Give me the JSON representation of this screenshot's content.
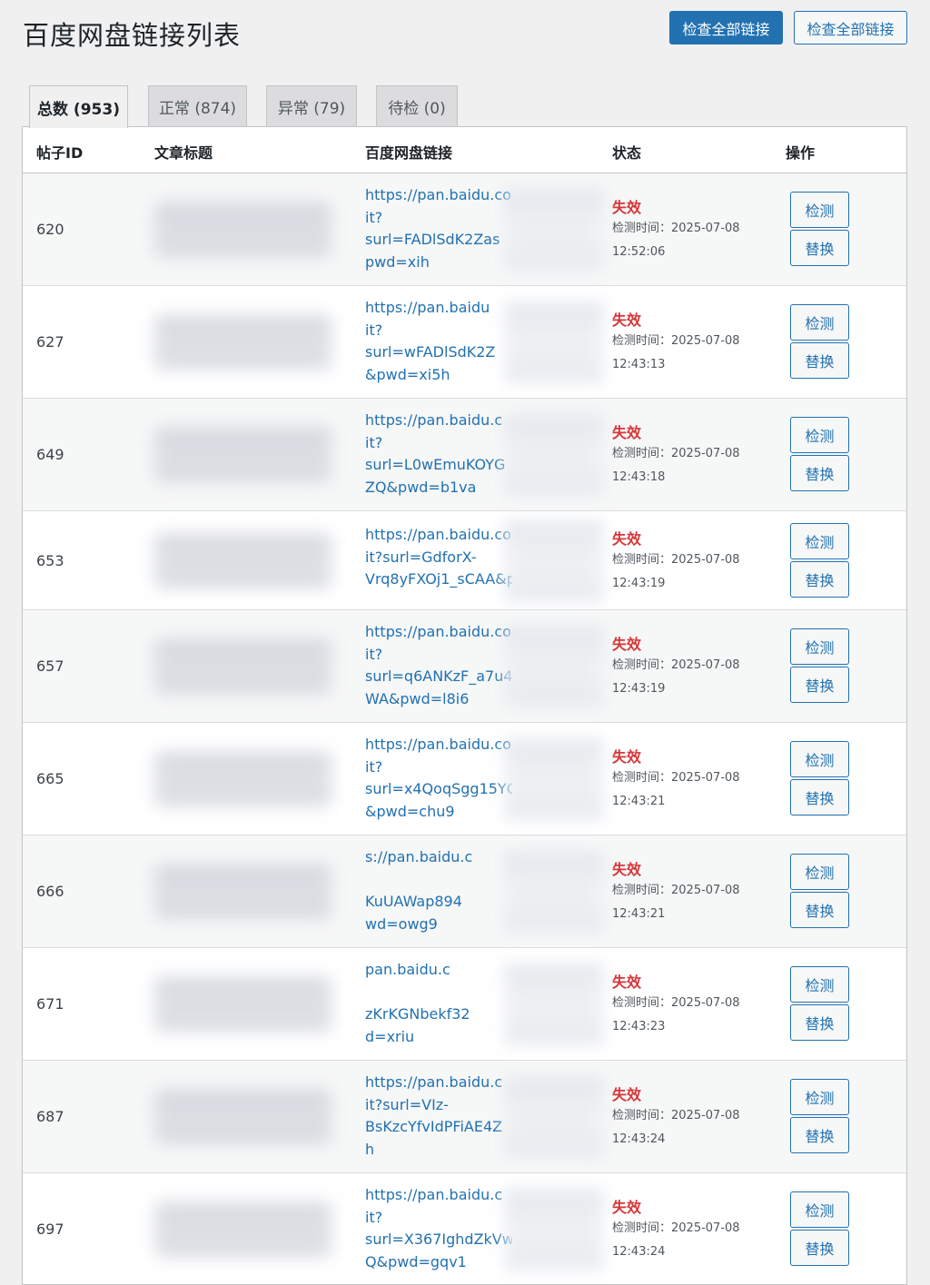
{
  "page": {
    "title": "百度网盘链接列表",
    "btn_primary": "检查全部链接",
    "btn_secondary": "检查全部链接"
  },
  "tabs": [
    {
      "label": "总数 (953)",
      "active": true
    },
    {
      "label": "正常 (874)",
      "active": false
    },
    {
      "label": "异常 (79)",
      "active": false
    },
    {
      "label": "待检 (0)",
      "active": false
    }
  ],
  "table": {
    "headers": [
      "帖子ID",
      "文章标题",
      "百度网盘链接",
      "状态",
      "操作"
    ],
    "action_check": "检测",
    "action_replace": "替换",
    "time_label": "检测时间：",
    "rows": [
      {
        "id": "620",
        "link": [
          "https://pan.baidu.co",
          "it?",
          "surl=FADlSdK2Zas",
          "pwd=xih"
        ],
        "status": "失效",
        "date": "2025-07-08",
        "time": "12:52:06"
      },
      {
        "id": "627",
        "link": [
          "https://pan.baidu",
          "it?",
          "surl=wFADlSdK2Z",
          "&pwd=xi5h"
        ],
        "status": "失效",
        "date": "2025-07-08",
        "time": "12:43:13"
      },
      {
        "id": "649",
        "link": [
          "https://pan.baidu.c",
          "it?",
          "surl=L0wEmuKOYG",
          "ZQ&pwd=b1va"
        ],
        "status": "失效",
        "date": "2025-07-08",
        "time": "12:43:18"
      },
      {
        "id": "653",
        "link": [
          "https://pan.baidu.cor",
          "it?surl=GdforX-",
          "Vrq8yFXOj1_sCAA&pw"
        ],
        "status": "失效",
        "date": "2025-07-08",
        "time": "12:43:19"
      },
      {
        "id": "657",
        "link": [
          "https://pan.baidu.con",
          "it?",
          "surl=q6ANKzF_a7u4X",
          "WA&pwd=l8i6"
        ],
        "status": "失效",
        "date": "2025-07-08",
        "time": "12:43:19"
      },
      {
        "id": "665",
        "link": [
          "https://pan.baidu.con",
          "it?",
          "surl=x4QoqSgg15YQ",
          "&pwd=chu9"
        ],
        "status": "失效",
        "date": "2025-07-08",
        "time": "12:43:21"
      },
      {
        "id": "666",
        "link": [
          "s://pan.baidu.c",
          "",
          "KuUAWap894",
          "wd=owg9"
        ],
        "status": "失效",
        "date": "2025-07-08",
        "time": "12:43:21"
      },
      {
        "id": "671",
        "link": [
          "pan.baidu.c",
          "",
          "zKrKGNbekf32",
          "d=xriu"
        ],
        "status": "失效",
        "date": "2025-07-08",
        "time": "12:43:23"
      },
      {
        "id": "687",
        "link": [
          "https://pan.baidu.c",
          "it?surl=VIz-",
          "BsKzcYfvIdPFiAE4Z",
          "h"
        ],
        "status": "失效",
        "date": "2025-07-08",
        "time": "12:43:24"
      },
      {
        "id": "697",
        "link": [
          "https://pan.baidu.c",
          "it?",
          "surl=X367IghdZkVw",
          "Q&pwd=gqv1"
        ],
        "status": "失效",
        "date": "2025-07-08",
        "time": "12:43:24"
      }
    ]
  }
}
